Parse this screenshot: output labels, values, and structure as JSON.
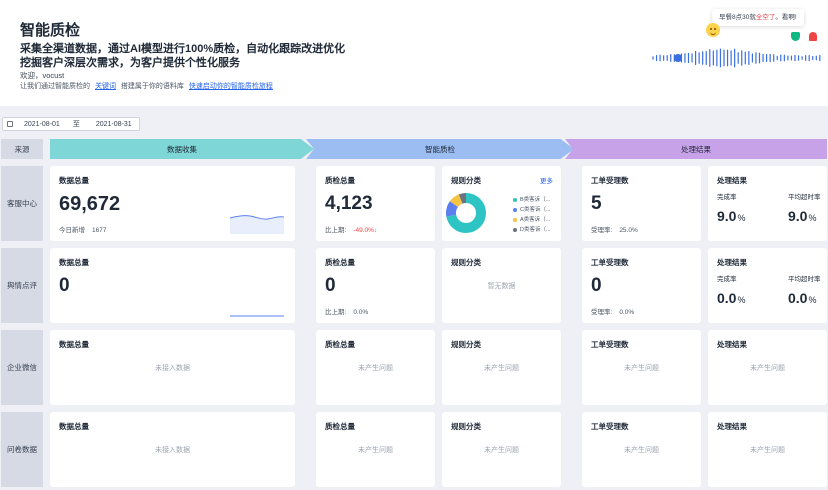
{
  "banner": {
    "title": "智能质检",
    "line1": "采集全渠道数据，通过AI模型进行100%质检，自动化跟踪改进优化",
    "line2": "挖掘客户深层次需求，为客户提供个性化服务",
    "welcome": "欢迎，vocust",
    "guide_prefix": "让我们通过智能质检的",
    "guide_link1": "关键词",
    "guide_middle": "搭建属于你的语料库",
    "guide_link2": "快速启动你的智能质检旅程",
    "bubble_prefix": "早餐8点30就",
    "bubble_highlight": "全空了",
    "bubble_suffix": "。看啊!"
  },
  "date_range": {
    "start": "2021-08-01",
    "separator": "至",
    "end": "2021-08-31"
  },
  "stages": {
    "source": "来源",
    "collect": "数据收集",
    "inspect": "智能质检",
    "result": "处理结果"
  },
  "labels": {
    "data_total": "数据总量",
    "qc_total": "质检总量",
    "rule_class": "规则分类",
    "ticket": "工单受理数",
    "result": "处理结果",
    "today_new": "今日新增",
    "vs_last": "比上期:",
    "accept_rate": "受理率:",
    "complete_rate": "完成率",
    "avg_overtime": "平均超时率",
    "more": "更多",
    "no_data": "暂无数据",
    "not_connected": "未接入数据",
    "no_issue": "未产生问题"
  },
  "rows": [
    {
      "source": "客服中心",
      "data_total": "69,672",
      "today_new": "1677",
      "qc_total": "4,123",
      "qc_change": "-49.0%",
      "ticket_count": "5",
      "accept_rate": "25.0%",
      "complete_rate": "9.0",
      "overtime_rate": "9.0",
      "legend": [
        "B类客诉（...",
        "C类客诉（...",
        "A类客诉（...",
        "D类客诉（..."
      ]
    },
    {
      "source": "舆情点评",
      "data_total": "0",
      "qc_total": "0",
      "qc_change": "0.0%",
      "ticket_count": "0",
      "accept_rate": "0.0%",
      "complete_rate": "0.0",
      "overtime_rate": "0.0"
    },
    {
      "source": "企业微信"
    },
    {
      "source": "问卷数据"
    }
  ],
  "pct_sign": "%",
  "chart_data": {
    "type": "pie",
    "categories": [
      "B类客诉（...",
      "C类客诉（...",
      "A类客诉（...",
      "D类客诉（..."
    ],
    "values": [
      72,
      13,
      9,
      6
    ],
    "colors": [
      "#2ec4c4",
      "#5b7ff0",
      "#f6c343",
      "#6b7280"
    ]
  },
  "colors": {
    "accent": "#2563eb",
    "down": "#ef4444"
  }
}
